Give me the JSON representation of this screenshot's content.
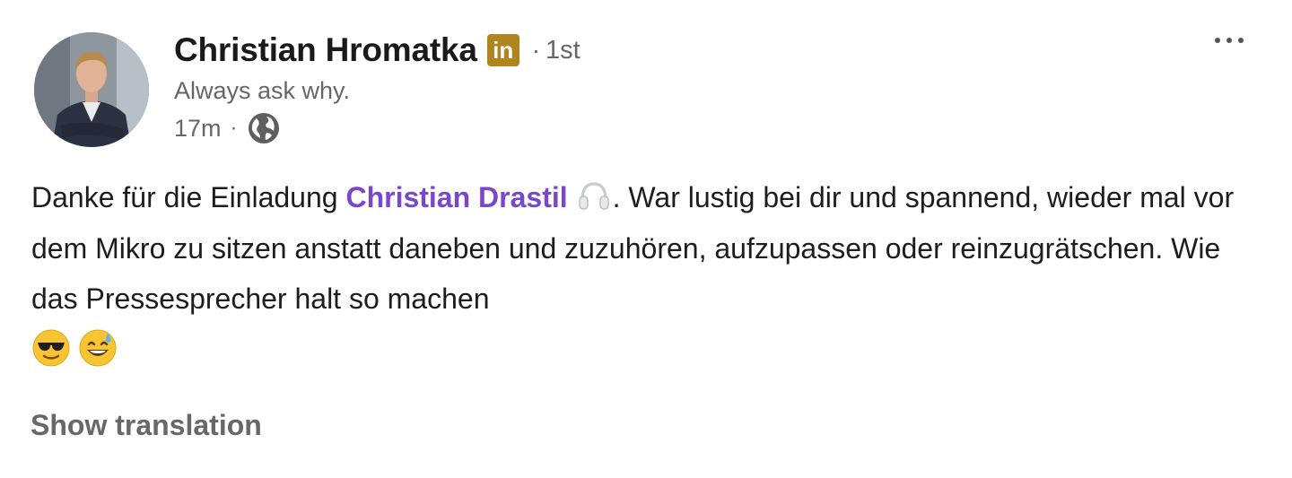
{
  "author": {
    "name": "Christian Hromatka",
    "badge_icon": "linkedin-premium-icon",
    "badge_text": "in",
    "badge_color": "#b0841f",
    "separator": "·",
    "connection_degree": "1st",
    "headline": "Always ask why."
  },
  "meta": {
    "timestamp": "17m",
    "separator": "·",
    "visibility_icon": "globe-icon"
  },
  "menu": {
    "icon": "more-options-icon"
  },
  "post": {
    "text_before_mention": "Danke für die Einladung ",
    "mention": "Christian Drastil",
    "mention_color": "#7a47c9",
    "inline_emoji_icon": "headphones-icon",
    "text_after_mention": ". War lustig bei dir und spannend, wieder mal vor dem Mikro zu sitzen anstatt daneben und zuzuhören, aufzupassen oder reinzugrätschen. Wie das Pressesprecher halt so machen",
    "trailing_emojis": [
      "sunglasses-face-icon",
      "grinning-sweat-face-icon"
    ]
  },
  "actions": {
    "show_translation": "Show translation"
  }
}
